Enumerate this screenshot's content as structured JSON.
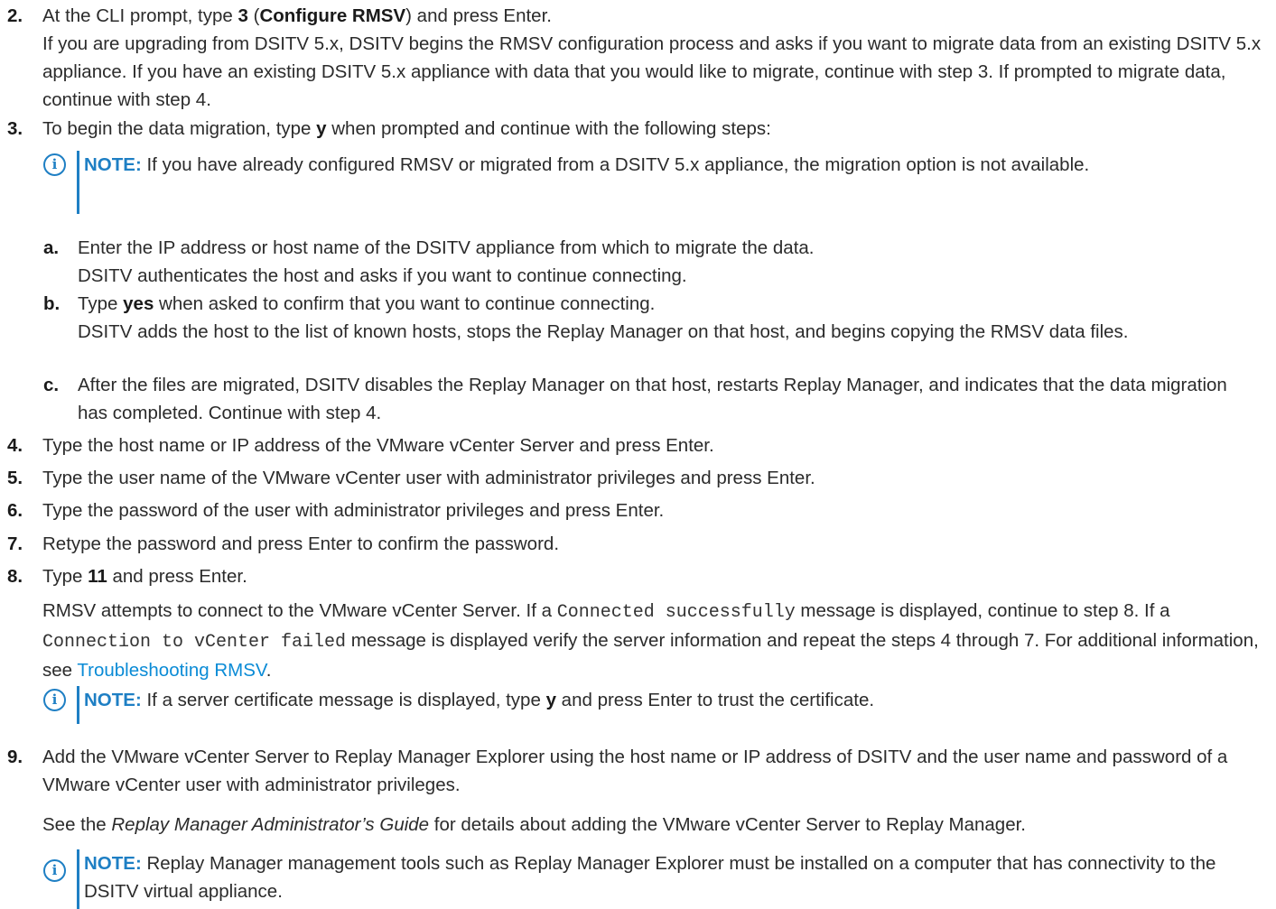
{
  "steps": {
    "s2": {
      "num": "2.",
      "p1_a": "At the CLI prompt, type ",
      "p1_b": "3",
      "p1_c": " (",
      "p1_d": "Configure RMSV",
      "p1_e": ") and press Enter.",
      "p2": "If you are upgrading from DSITV 5.x, DSITV begins the RMSV configuration process and asks if you want to migrate data from an existing DSITV 5.x appliance. If you have an existing DSITV 5.x appliance with data that you would like to migrate, continue with step 3. If prompted to migrate data, continue with step 4."
    },
    "s3": {
      "num": "3.",
      "p1_a": "To begin the data migration, type ",
      "p1_b": "y",
      "p1_c": " when prompted and continue with the following steps:",
      "note_label": "NOTE:",
      "note_text": " If you have already configured RMSV or migrated from a DSITV 5.x appliance, the migration option is not available.",
      "a_num": "a.",
      "a_p1": "Enter the IP address or host name of the DSITV appliance from which to migrate the data.",
      "a_p2": "DSITV authenticates the host and asks if you want to continue connecting.",
      "b_num": "b.",
      "b_p1_a": "Type ",
      "b_p1_b": "yes",
      "b_p1_c": " when asked to confirm that you want to continue connecting.",
      "b_p2": "DSITV adds the host to the list of known hosts, stops the Replay Manager on that host, and begins copying the RMSV data files.",
      "c_num": "c.",
      "c_p1": "After the files are migrated, DSITV disables the Replay Manager on that host, restarts Replay Manager, and indicates that the data migration has completed. Continue with step 4."
    },
    "s4": {
      "num": "4.",
      "text": "Type the host name or IP address of the VMware vCenter Server and press Enter."
    },
    "s5": {
      "num": "5.",
      "text": "Type the user name of the VMware vCenter user with administrator privileges and press Enter."
    },
    "s6": {
      "num": "6.",
      "text": "Type the password of the user with administrator privileges and press Enter."
    },
    "s7": {
      "num": "7.",
      "text": "Retype the password and press Enter to confirm the password."
    },
    "s8": {
      "num": "8.",
      "p1_a": "Type ",
      "p1_b": "11",
      "p1_c": " and press Enter.",
      "p2_a": "RMSV attempts to connect to the VMware vCenter Server. If a ",
      "p2_code1": "Connected successfully",
      "p2_b": " message is displayed, continue to step 8. If a ",
      "p2_code2": "Connection to vCenter failed",
      "p2_c": " message is displayed verify the server information and repeat the steps 4 through 7. For additional information, see ",
      "p2_link": "Troubleshooting RMSV",
      "p2_d": ".",
      "note_label": "NOTE:",
      "note_a": " If a server certificate message is displayed, type ",
      "note_b": "y",
      "note_c": " and press Enter to trust the certificate."
    },
    "s9": {
      "num": "9.",
      "p1": "Add the VMware vCenter Server to Replay Manager Explorer using the host name or IP address of DSITV and the user name and password of a VMware vCenter user with administrator privileges.",
      "p2_a": "See the ",
      "p2_italic": "Replay Manager Administrator’s Guide",
      "p2_b": " for details about adding the VMware vCenter Server to Replay Manager.",
      "note_label": "NOTE:",
      "note_text": " Replay Manager management tools such as Replay Manager Explorer must be installed on a computer that has connectivity to the DSITV virtual appliance."
    }
  },
  "icons": {
    "note": "info-circle-icon",
    "glyph": "i"
  },
  "colors": {
    "accent": "#1e7fc4",
    "link": "#0a8bd6",
    "text": "#2b2b2b"
  }
}
